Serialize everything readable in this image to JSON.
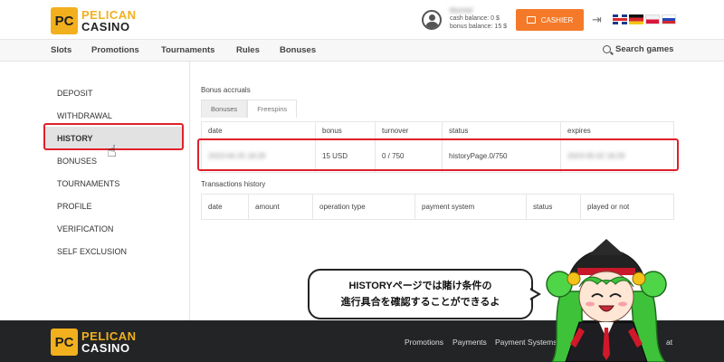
{
  "header": {
    "logo": {
      "badge": "PC",
      "line1": "PELICAN",
      "line2": "CASINO"
    },
    "user": {
      "name": "blurred",
      "cash_balance": "cash balance:  0 $",
      "bonus_balance": "bonus balance:   15 $"
    },
    "cashier_label": "CASHIER",
    "languages": [
      "en",
      "de",
      "pl",
      "ru"
    ]
  },
  "nav": {
    "items": [
      "Slots",
      "Promotions",
      "Tournaments",
      "Rules",
      "Bonuses"
    ],
    "search_label": "Search games"
  },
  "sidebar": {
    "items": [
      "DEPOSIT",
      "WITHDRAWAL",
      "HISTORY",
      "BONUSES",
      "TOURNAMENTS",
      "PROFILE",
      "VERIFICATION",
      "SELF EXCLUSION"
    ],
    "active": "HISTORY"
  },
  "bonus_accruals": {
    "title": "Bonus accruals",
    "tabs": [
      "Bonuses",
      "Freespins"
    ],
    "columns": [
      "date",
      "bonus",
      "turnover",
      "status",
      "expires"
    ],
    "row": {
      "date": "2023-04-25 18:29",
      "bonus": "15 USD",
      "turnover": "0 / 750",
      "status": "historyPage.0/750",
      "expires": "2023-05-02 18:29"
    }
  },
  "transactions": {
    "title": "Transactions history",
    "columns": [
      "date",
      "amount",
      "operation type",
      "payment system",
      "status",
      "played or not"
    ]
  },
  "footer": {
    "logo": {
      "badge": "PC",
      "line1": "PELICAN",
      "line2": "CASINO"
    },
    "links": [
      "Promotions",
      "Payments",
      "Payment Systems",
      "at"
    ]
  },
  "bubble": {
    "line1": "HISTORYページでは賭け条件の",
    "line2": "進行具合を確認することができるよ"
  },
  "colors": {
    "accent": "#f47a2a",
    "brand": "#f2b01e",
    "highlight": "#e0202a",
    "footer": "#222426"
  },
  "icons": [
    "user-avatar-icon",
    "wallet-icon",
    "logout-icon",
    "search-icon",
    "hand-pointer-icon"
  ]
}
